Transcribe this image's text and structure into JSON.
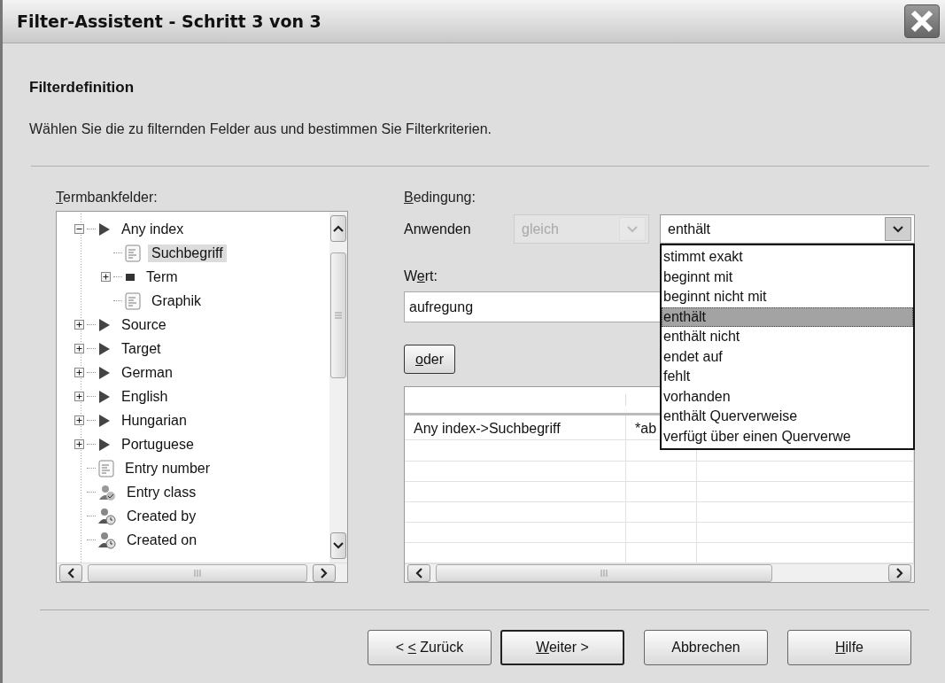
{
  "window": {
    "title": "Filter-Assistent - Schritt 3 von 3"
  },
  "heading": "Filterdefinition",
  "description": "Wählen Sie die zu filternden Felder aus und bestimmen Sie Filterkriterien.",
  "fields_label": {
    "key": "T",
    "post": "ermbankfelder:"
  },
  "tree": [
    {
      "label": "Any index",
      "kind": "group",
      "expanded": true,
      "selected": false,
      "children": [
        {
          "label": "Suchbegriff",
          "kind": "field",
          "selected": true
        },
        {
          "label": "Term",
          "kind": "term",
          "expanded": false,
          "selected": false
        },
        {
          "label": "Graphik",
          "kind": "field",
          "selected": false
        }
      ]
    },
    {
      "label": "Source",
      "kind": "group",
      "expanded": false,
      "selected": false
    },
    {
      "label": "Target",
      "kind": "group",
      "expanded": false,
      "selected": false
    },
    {
      "label": "German",
      "kind": "group",
      "expanded": false,
      "selected": false
    },
    {
      "label": "English",
      "kind": "group",
      "expanded": false,
      "selected": false
    },
    {
      "label": "Hungarian",
      "kind": "group",
      "expanded": false,
      "selected": false
    },
    {
      "label": "Portuguese",
      "kind": "group",
      "expanded": false,
      "selected": false
    },
    {
      "label": "Entry number",
      "kind": "field",
      "selected": false
    },
    {
      "label": "Entry class",
      "kind": "class",
      "selected": false
    },
    {
      "label": "Created by",
      "kind": "user",
      "selected": false
    },
    {
      "label": "Created on",
      "kind": "user",
      "selected": false
    }
  ],
  "condition": {
    "label": {
      "key": "B",
      "post": "edingung:"
    },
    "apply_label": "Anwenden",
    "operator": {
      "value": "gleich",
      "disabled": true
    },
    "criterion": {
      "value": "enthält",
      "expanded": true,
      "options": [
        {
          "label": "stimmt exakt",
          "selected": false
        },
        {
          "label": "beginnt mit",
          "selected": false
        },
        {
          "label": "beginnt nicht mit",
          "selected": false
        },
        {
          "label": "enthält",
          "selected": true
        },
        {
          "label": "enthält nicht",
          "selected": false
        },
        {
          "label": "endet auf",
          "selected": false
        },
        {
          "label": "fehlt",
          "selected": false
        },
        {
          "label": "vorhanden",
          "selected": false
        },
        {
          "label": "enthält Querverweise",
          "selected": false
        },
        {
          "label": "verfügt über einen Querverwe",
          "selected": false
        }
      ]
    }
  },
  "value": {
    "label": {
      "pre": "W",
      "key": "e",
      "post": "rt:"
    },
    "value": "aufregung"
  },
  "or_button": {
    "key": "o",
    "post": "der"
  },
  "table": {
    "rows": [
      [
        "Any index->Suchbegriff",
        "*ab"
      ]
    ]
  },
  "buttons": [
    {
      "label": {
        "pre": "< ",
        "key": "<",
        "post": " Zurück"
      },
      "default": false
    },
    {
      "label": {
        "key": "W",
        "post": "eiter >"
      },
      "default": true
    },
    {
      "label": {
        "pre": "Abbrechen"
      },
      "default": false
    },
    {
      "label": {
        "key": "H",
        "post": "ilfe"
      },
      "default": false
    }
  ]
}
